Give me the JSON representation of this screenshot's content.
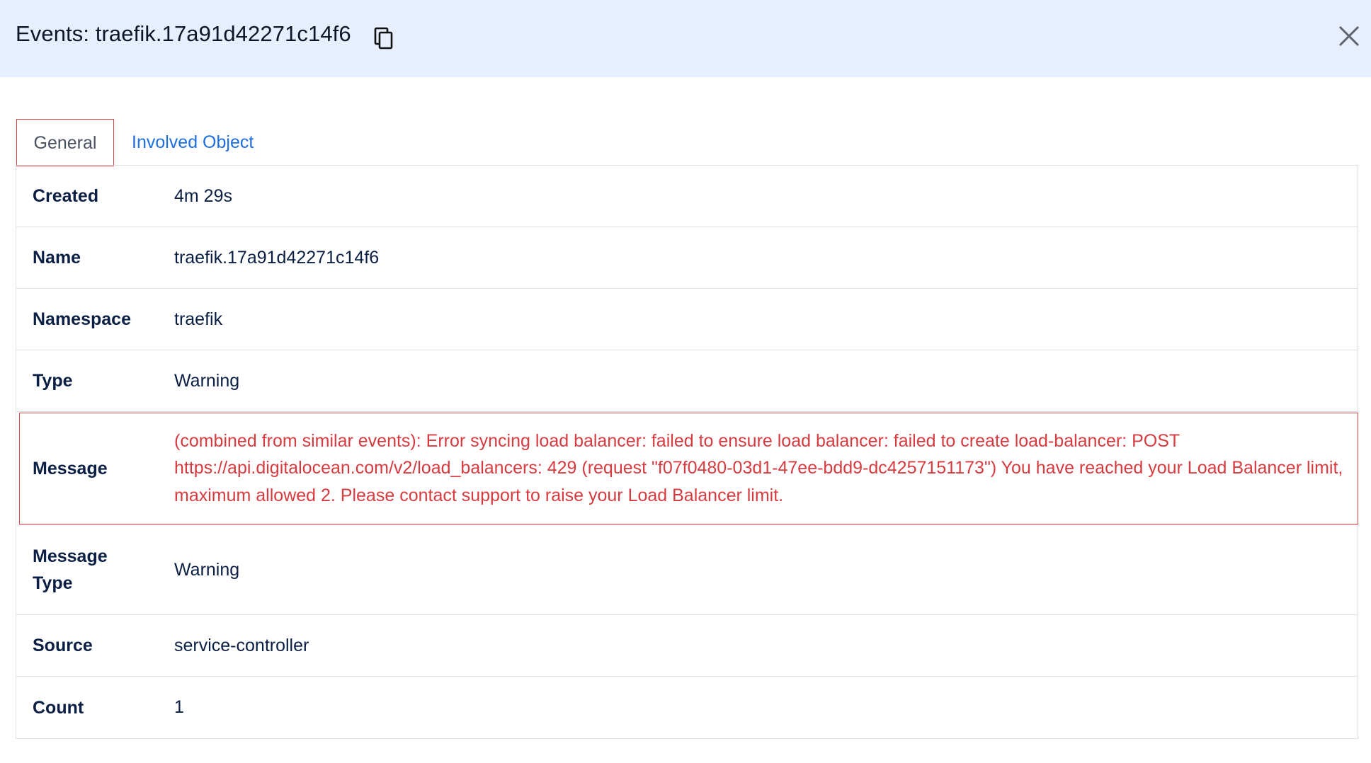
{
  "header": {
    "title": "Events: traefik.17a91d42271c14f6"
  },
  "tabs": [
    {
      "label": "General"
    },
    {
      "label": "Involved Object"
    }
  ],
  "details": [
    {
      "label": "Created",
      "value": "4m 29s"
    },
    {
      "label": "Name",
      "value": "traefik.17a91d42271c14f6"
    },
    {
      "label": "Namespace",
      "value": "traefik"
    },
    {
      "label": "Type",
      "value": "Warning"
    },
    {
      "label": "Message",
      "value": "(combined from similar events): Error syncing load balancer: failed to ensure load balancer: failed to create load-balancer: POST https://api.digitalocean.com/v2/load_balancers: 429 (request \"f07f0480-03d1-47ee-bdd9-dc4257151173\") You have reached your Load Balancer limit, maximum allowed 2. Please contact support to raise your Load Balancer limit."
    },
    {
      "label": "Message Type",
      "value": "Warning"
    },
    {
      "label": "Source",
      "value": "service-controller"
    },
    {
      "label": "Count",
      "value": "1"
    }
  ]
}
